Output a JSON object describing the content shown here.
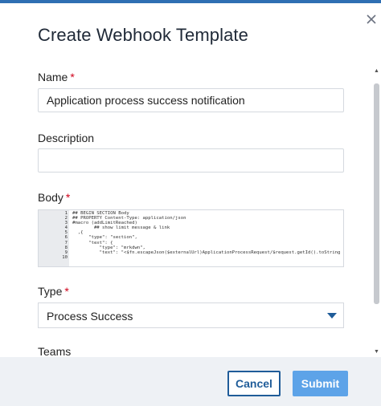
{
  "dialog": {
    "title": "Create Webhook Template",
    "close_icon": "close-icon"
  },
  "form": {
    "name_label": "Name",
    "name_required": "*",
    "name_value": "Application process success notification",
    "description_label": "Description",
    "description_value": "",
    "body_label": "Body",
    "body_required": "*",
    "body_lines": [
      {
        "num": "1",
        "text": "## BEGIN SECTION Body"
      },
      {
        "num": "2",
        "text": "## PROPERTY Content-Type: application/json"
      },
      {
        "num": "3",
        "text": "#macro (addLimitReached)"
      },
      {
        "num": "4",
        "text": "        ## show limit message & link"
      },
      {
        "num": "5",
        "text": "  ,{"
      },
      {
        "num": "6",
        "text": "      \"type\": \"section\","
      },
      {
        "num": "7",
        "text": "      \"text\": {"
      },
      {
        "num": "8",
        "text": "          \"type\": \"mrkdwn\","
      },
      {
        "num": "9",
        "text": "          \"text\": \"<$fn.escapeJson($externalUrl)ApplicationProcessRequest/$request.getId().toString"
      },
      {
        "num": "10",
        "text": ""
      }
    ],
    "type_label": "Type",
    "type_required": "*",
    "type_value": "Process Success",
    "teams_label": "Teams"
  },
  "footer": {
    "cancel_label": "Cancel",
    "submit_label": "Submit"
  },
  "colors": {
    "accent": "#1f5c99",
    "submit_bg": "#5da3e8",
    "required": "#d0021b",
    "top_bar": "#2f6fb3"
  }
}
